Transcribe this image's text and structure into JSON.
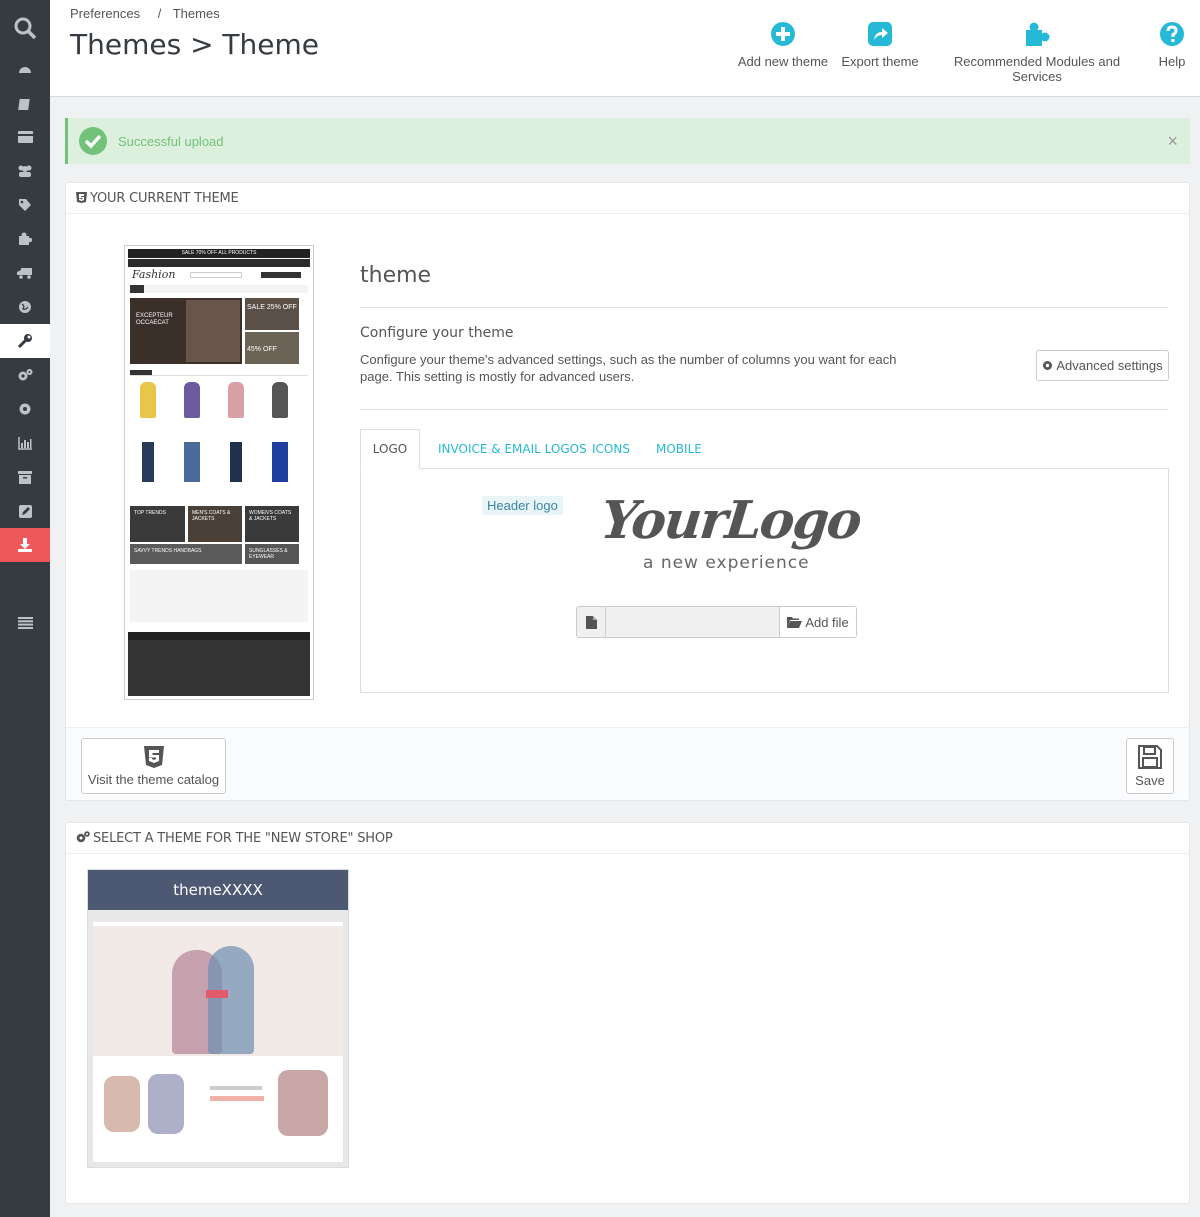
{
  "breadcrumb": {
    "part1": "Preferences",
    "sep": "/",
    "part2": "Themes"
  },
  "page_title": "Themes > Theme",
  "toolbar": {
    "add_new_theme": "Add new theme",
    "export_theme": "Export theme",
    "recommended": "Recommended Modules and Services",
    "help": "Help"
  },
  "alert": {
    "message": "Successful upload",
    "close": "×"
  },
  "current_theme": {
    "heading": "YOUR CURRENT THEME",
    "name": "theme",
    "configure_title": "Configure your theme",
    "configure_desc": "Configure your theme's advanced settings, such as the number of columns you want for each page. This setting is mostly for advanced users.",
    "advanced_settings": "Advanced settings",
    "tabs": [
      "LOGO",
      "INVOICE & EMAIL LOGOS",
      "ICONS",
      "MOBILE"
    ],
    "header_logo_label": "Header logo",
    "logo_text": "YourLogo",
    "logo_tagline": "a new experience",
    "add_file": "Add file",
    "visit_catalog": "Visit the theme catalog",
    "save": "Save",
    "preview": {
      "topbar": "SALE 70% OFF ALL PRODUCTS",
      "brand": "Fashion",
      "banner_left": "EXCEPTEUR OCCAECAT",
      "banner_right_1": "SALE 25% OFF",
      "banner_right_2": "45% OFF",
      "block_1": "TOP TRENDS",
      "block_2": "MEN'S COATS & JACKETS",
      "block_3": "WOMEN'S COATS & JACKETS",
      "block_4": "SAVVY TRENDS HANDBAGS",
      "block_5": "SUNGLASSES & EYEWEAR"
    }
  },
  "select_theme": {
    "heading": "SELECT A THEME FOR THE \"NEW STORE\" SHOP",
    "card_title": "themeXXXX"
  },
  "colors": {
    "accent": "#25b9d7",
    "sidebar": "#363a41",
    "active_red": "#f0575a",
    "success": "#72c279"
  },
  "sidebar_icons": [
    "search-icon",
    "dashboard-icon",
    "orders-icon",
    "catalog-icon",
    "customers-icon",
    "tag-icon",
    "modules-icon",
    "shipping-icon",
    "localization-icon",
    "preferences-icon",
    "advanced-params-icon",
    "admin-icon",
    "stats-icon",
    "archive-icon",
    "edit-icon",
    "download-icon",
    "menu-icon"
  ]
}
